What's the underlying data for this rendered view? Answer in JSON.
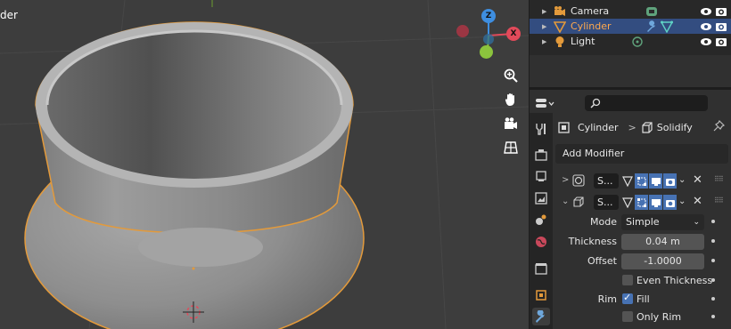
{
  "viewport": {
    "title_fragment": "der",
    "gizmo": {
      "z": "Z",
      "x": "X"
    },
    "nav_icons": [
      "zoom-icon",
      "hand-pan-icon",
      "camera-icon",
      "grid-icon"
    ]
  },
  "outliner": {
    "rows": [
      {
        "label": "Camera",
        "icon": "camera-object-icon",
        "data_icon": "camera-data-icon",
        "selected": false
      },
      {
        "label": "Cylinder",
        "icon": "mesh-object-icon",
        "data_icon": "wrench-icon",
        "selected": true
      },
      {
        "label": "Light",
        "icon": "light-object-icon",
        "data_icon": "light-data-icon",
        "selected": false
      }
    ]
  },
  "properties": {
    "search_placeholder": "",
    "breadcrumb": {
      "object": "Cylinder",
      "separator": ">",
      "modifier": "Solidify"
    },
    "add_modifier_label": "Add Modifier",
    "modifiers": [
      {
        "name": "S...",
        "expanded": false,
        "icon": "circle-modifier-icon"
      },
      {
        "name": "S...",
        "expanded": true,
        "icon": "solidify-modifier-icon"
      }
    ],
    "fields": {
      "mode_label": "Mode",
      "mode_value": "Simple",
      "thickness_label": "Thickness",
      "thickness_value": "0.04 m",
      "offset_label": "Offset",
      "offset_value": "-1.0000",
      "even_thickness_label": "Even Thickness",
      "even_thickness_checked": false,
      "rim_label": "Rim",
      "fill_label": "Fill",
      "fill_checked": true,
      "only_rim_label": "Only Rim",
      "only_rim_checked": false
    }
  },
  "colors": {
    "selection": "#334d80",
    "accent_blue": "#4772b3",
    "object_orange": "#e39a3b",
    "gizmo_x": "#e24a5a",
    "gizmo_y": "#8bc33d",
    "gizmo_z": "#3e8ee0"
  }
}
